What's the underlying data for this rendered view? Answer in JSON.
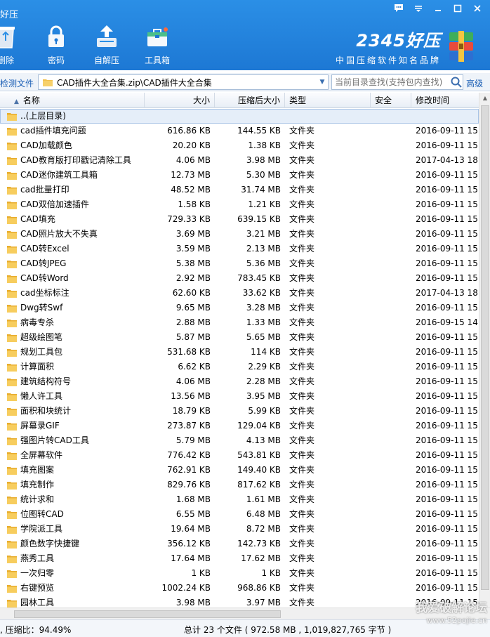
{
  "window": {
    "title": "好压",
    "controls": [
      "chat-icon",
      "menu-icon",
      "minimize-icon",
      "maximize-icon",
      "close-icon"
    ]
  },
  "toolbar": {
    "items": [
      {
        "label": "删除",
        "icon": "recycle-icon"
      },
      {
        "label": "密码",
        "icon": "lock-icon"
      },
      {
        "label": "自解压",
        "icon": "self-extract-icon"
      },
      {
        "label": "工具箱",
        "icon": "toolbox-icon"
      }
    ]
  },
  "brand": {
    "name": "2345好压",
    "slogan": "中国压缩软件知名品牌",
    "logo_icon": "archive-books-icon"
  },
  "address": {
    "detect_label": "检测文件",
    "path": "CAD插件大全合集.zip\\CAD插件大全合集",
    "search_placeholder": "当前目录查找(支持包内查找)",
    "advanced_label": "高级"
  },
  "columns": {
    "name": "名称",
    "size": "大小",
    "compressed": "压缩后大小",
    "type": "类型",
    "security": "安全",
    "modified": "修改时间"
  },
  "parent_row": "..(上层目录)",
  "files": [
    {
      "name": "cad插件填充问题",
      "size": "616.86 KB",
      "compressed": "144.55 KB",
      "type": "文件夹",
      "time": "2016-09-11 15:"
    },
    {
      "name": "CAD加载颜色",
      "size": "20.20 KB",
      "compressed": "1.38 KB",
      "type": "文件夹",
      "time": "2016-09-11 15:"
    },
    {
      "name": "CAD教育版打印戳记清除工具",
      "size": "4.06 MB",
      "compressed": "3.98 MB",
      "type": "文件夹",
      "time": "2017-04-13 18:"
    },
    {
      "name": "CAD迷你建筑工具箱",
      "size": "12.73 MB",
      "compressed": "5.30 MB",
      "type": "文件夹",
      "time": "2016-09-11 15:"
    },
    {
      "name": "cad批量打印",
      "size": "48.52 MB",
      "compressed": "31.74 MB",
      "type": "文件夹",
      "time": "2016-09-11 15:"
    },
    {
      "name": "CAD双倍加速插件",
      "size": "1.58 KB",
      "compressed": "1.21 KB",
      "type": "文件夹",
      "time": "2016-09-11 15:"
    },
    {
      "name": "CAD填充",
      "size": "729.33 KB",
      "compressed": "639.15 KB",
      "type": "文件夹",
      "time": "2016-09-11 15:"
    },
    {
      "name": "CAD照片放大不失真",
      "size": "3.69 MB",
      "compressed": "3.21 MB",
      "type": "文件夹",
      "time": "2016-09-11 15:"
    },
    {
      "name": "CAD转Excel",
      "size": "3.59 MB",
      "compressed": "2.13 MB",
      "type": "文件夹",
      "time": "2016-09-11 15:"
    },
    {
      "name": "CAD转JPEG",
      "size": "5.38 MB",
      "compressed": "5.36 MB",
      "type": "文件夹",
      "time": "2016-09-11 15:"
    },
    {
      "name": "CAD转Word",
      "size": "2.92 MB",
      "compressed": "783.45 KB",
      "type": "文件夹",
      "time": "2016-09-11 15:"
    },
    {
      "name": "cad坐标标注",
      "size": "62.60 KB",
      "compressed": "33.62 KB",
      "type": "文件夹",
      "time": "2017-04-13 18:"
    },
    {
      "name": "Dwg转Swf",
      "size": "9.65 MB",
      "compressed": "3.28 MB",
      "type": "文件夹",
      "time": "2016-09-11 15:"
    },
    {
      "name": "病毒专杀",
      "size": "2.88 MB",
      "compressed": "1.33 MB",
      "type": "文件夹",
      "time": "2016-09-15 14:"
    },
    {
      "name": "超级绘图笔",
      "size": "5.87 MB",
      "compressed": "5.65 MB",
      "type": "文件夹",
      "time": "2016-09-11 15:"
    },
    {
      "name": "规划工具包",
      "size": "531.68 KB",
      "compressed": "114 KB",
      "type": "文件夹",
      "time": "2016-09-11 15:"
    },
    {
      "name": "计算面积",
      "size": "6.62 KB",
      "compressed": "2.29 KB",
      "type": "文件夹",
      "time": "2016-09-11 15:"
    },
    {
      "name": "建筑结构符号",
      "size": "4.06 MB",
      "compressed": "2.28 MB",
      "type": "文件夹",
      "time": "2016-09-11 15:"
    },
    {
      "name": "懒人许工具",
      "size": "13.56 MB",
      "compressed": "3.95 MB",
      "type": "文件夹",
      "time": "2016-09-11 15:"
    },
    {
      "name": "面积和块统计",
      "size": "18.79 KB",
      "compressed": "5.99 KB",
      "type": "文件夹",
      "time": "2016-09-11 15:"
    },
    {
      "name": "屏幕录GIF",
      "size": "273.87 KB",
      "compressed": "129.04 KB",
      "type": "文件夹",
      "time": "2016-09-11 15:"
    },
    {
      "name": "强图片转CAD工具",
      "size": "5.79 MB",
      "compressed": "4.13 MB",
      "type": "文件夹",
      "time": "2016-09-11 15:"
    },
    {
      "name": "全屏幕软件",
      "size": "776.42 KB",
      "compressed": "543.81 KB",
      "type": "文件夹",
      "time": "2016-09-11 15:"
    },
    {
      "name": "填充图案",
      "size": "762.91 KB",
      "compressed": "149.40 KB",
      "type": "文件夹",
      "time": "2016-09-11 15:"
    },
    {
      "name": "填充制作",
      "size": "829.76 KB",
      "compressed": "817.62 KB",
      "type": "文件夹",
      "time": "2016-09-11 15:"
    },
    {
      "name": "统计求和",
      "size": "1.68 MB",
      "compressed": "1.61 MB",
      "type": "文件夹",
      "time": "2016-09-11 15:"
    },
    {
      "name": "位图转CAD",
      "size": "6.55 MB",
      "compressed": "6.48 MB",
      "type": "文件夹",
      "time": "2016-09-11 15:"
    },
    {
      "name": "学院派工具",
      "size": "19.64 MB",
      "compressed": "8.72 MB",
      "type": "文件夹",
      "time": "2016-09-11 15:"
    },
    {
      "name": "颜色数字快捷键",
      "size": "356.12 KB",
      "compressed": "142.73 KB",
      "type": "文件夹",
      "time": "2016-09-11 15:"
    },
    {
      "name": "燕秀工具",
      "size": "17.64 MB",
      "compressed": "17.62 MB",
      "type": "文件夹",
      "time": "2016-09-11 15:"
    },
    {
      "name": "一次归零",
      "size": "1 KB",
      "compressed": "1 KB",
      "type": "文件夹",
      "time": "2016-09-11 15:"
    },
    {
      "name": "右键预览",
      "size": "1002.24 KB",
      "compressed": "968.86 KB",
      "type": "文件夹",
      "time": "2016-09-11 15:"
    },
    {
      "name": "园林工具",
      "size": "3.98 MB",
      "compressed": "3.97 MB",
      "type": "文件夹",
      "time": "2016-09-11 15:"
    }
  ],
  "status": {
    "ratio": ", 压缩比：94.49%",
    "total": "总计 23 个文件 ( 972.58 MB , 1,019,827,765 字节 )"
  },
  "watermark": {
    "line1": "我爱破解论坛",
    "line2": "www.52pojie.cn"
  },
  "colors": {
    "titlebar": "#1d78d4",
    "folder": "#f2c14e",
    "link": "#1b5fb5"
  }
}
